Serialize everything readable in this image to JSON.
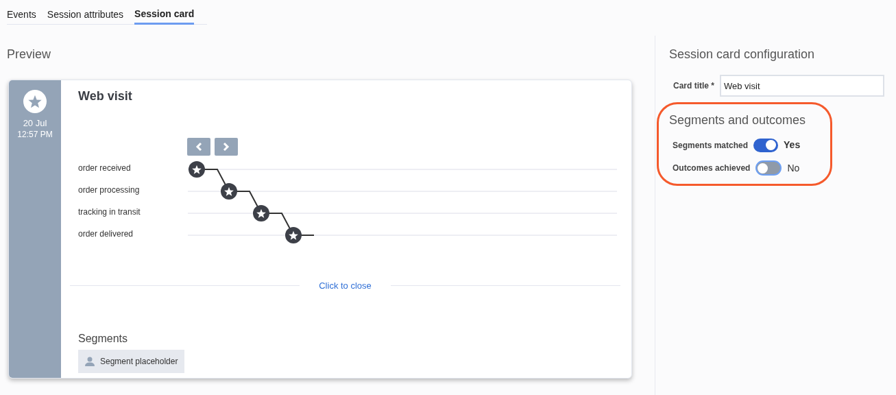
{
  "tabs": [
    {
      "label": "Events",
      "selected": false
    },
    {
      "label": "Session attributes",
      "selected": false
    },
    {
      "label": "Session card",
      "selected": true
    }
  ],
  "preview": {
    "heading": "Preview",
    "card": {
      "date": "20 Jul",
      "time": "12:57 PM",
      "title": "Web visit",
      "steps": [
        "order received",
        "order processing",
        "tracking in transit",
        "order delivered"
      ],
      "close_link": "Click to close",
      "segments_heading": "Segments",
      "segments": [
        "Segment placeholder"
      ]
    }
  },
  "config": {
    "heading": "Session card configuration",
    "card_title": {
      "label": "Card title *",
      "value": "Web visit"
    },
    "section": {
      "heading": "Segments and outcomes",
      "highlighted": true,
      "toggles": [
        {
          "label": "Segments matched",
          "on": true,
          "value": "Yes"
        },
        {
          "label": "Outcomes achieved",
          "on": false,
          "value": "No"
        }
      ]
    }
  }
}
